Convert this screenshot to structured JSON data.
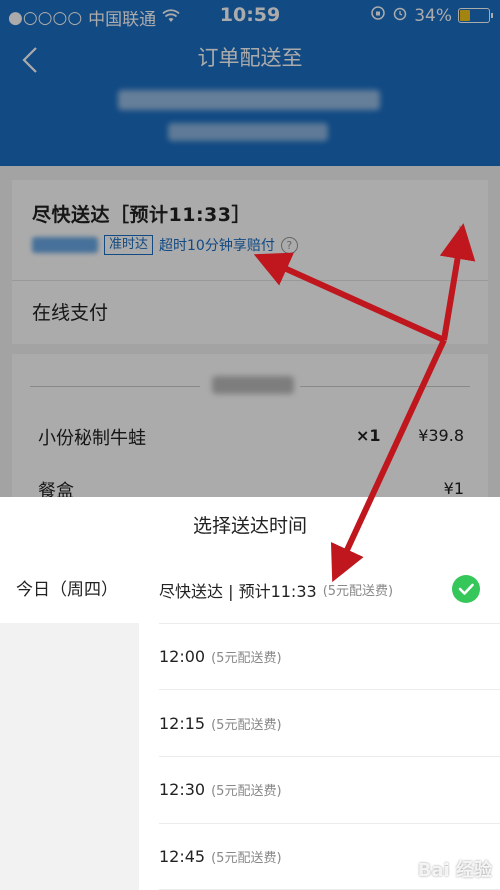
{
  "status_bar": {
    "signal": "●○○○○",
    "carrier": "中国联通",
    "wifi_icon": "wifi-icon",
    "time": "10:59",
    "battery": "34%",
    "battery_level": 0.34
  },
  "header": {
    "title": "订单配送至"
  },
  "order": {
    "deliver_label": "尽快送达［预计11:33］",
    "ontime_badge": "准时达",
    "overtime_text": "超时10分钟享赔付",
    "help": "?",
    "chevron": "›",
    "payment": "在线支付"
  },
  "items": [
    {
      "name": "小份秘制牛蛙",
      "qty": "×1",
      "price": "¥39.8"
    },
    {
      "name": "餐盒",
      "qty": "",
      "price": "¥1"
    }
  ],
  "sheet": {
    "title": "选择送达时间",
    "day": "今日（周四）",
    "slots": [
      {
        "time": "尽快送达 | 预计11:33",
        "fee": "(5元配送费)",
        "selected": true
      },
      {
        "time": "12:00",
        "fee": "(5元配送费)",
        "selected": false
      },
      {
        "time": "12:15",
        "fee": "(5元配送费)",
        "selected": false
      },
      {
        "time": "12:30",
        "fee": "(5元配送费)",
        "selected": false
      },
      {
        "time": "12:45",
        "fee": "(5元配送费)",
        "selected": false
      }
    ]
  },
  "watermark": "Bai 经验",
  "colors": {
    "brand": "#1b6fc4",
    "check": "#36c75a",
    "arrow": "#c0161d"
  }
}
